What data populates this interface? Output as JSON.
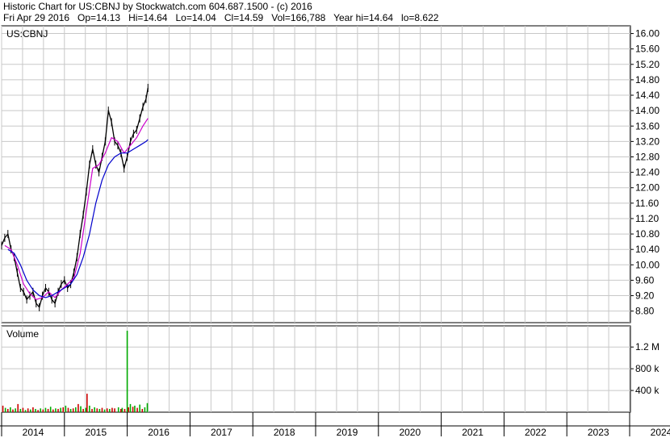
{
  "header": {
    "line1": "Historic Chart for US:CBNJ by Stockwatch.com 604.687.1500 - (c) 2016",
    "line2": "Fri Apr 29 2016   Op=14.13   Hi=14.64   Lo=14.04   Cl=14.59   Vol=166,788   Year hi=14.64   lo=8.622"
  },
  "chart_data": [
    {
      "type": "line",
      "title": "US:CBNJ",
      "ylabel": "",
      "xlabel": "",
      "ylim": [
        8.5,
        16.2
      ],
      "yticks": [
        "16.00",
        "15.60",
        "15.20",
        "14.80",
        "14.40",
        "14.00",
        "13.60",
        "13.20",
        "12.80",
        "12.40",
        "12.00",
        "11.60",
        "11.20",
        "10.80",
        "10.40",
        "10.00",
        "9.60",
        "9.20",
        "8.80"
      ],
      "x_labels": [
        "2014",
        "2015",
        "2016",
        "2017",
        "2018",
        "2019",
        "2020",
        "2021",
        "2022",
        "2023",
        "2024"
      ],
      "grid": true,
      "series": [
        {
          "style": "price",
          "color": "#000000",
          "x": [
            2014.0,
            2014.05,
            2014.1,
            2014.15,
            2014.2,
            2014.25,
            2014.3,
            2014.35,
            2014.4,
            2014.45,
            2014.5,
            2014.55,
            2014.6,
            2014.65,
            2014.7,
            2014.75,
            2014.8,
            2014.85,
            2014.9,
            2014.95,
            2015.0,
            2015.05,
            2015.1,
            2015.15,
            2015.2,
            2015.25,
            2015.3,
            2015.35,
            2015.4,
            2015.45,
            2015.5,
            2015.55,
            2015.6,
            2015.65,
            2015.7,
            2015.75,
            2015.8,
            2015.85,
            2015.9,
            2015.95,
            2016.0,
            2016.05,
            2016.1,
            2016.15,
            2016.2,
            2016.25,
            2016.3,
            2016.33
          ],
          "values": [
            10.5,
            10.7,
            10.8,
            10.4,
            10.2,
            9.8,
            9.4,
            9.3,
            9.1,
            9.2,
            9.3,
            9.0,
            8.9,
            9.2,
            9.4,
            9.3,
            9.1,
            9.0,
            9.3,
            9.5,
            9.6,
            9.4,
            9.5,
            9.8,
            10.2,
            10.8,
            11.3,
            11.9,
            12.6,
            13.0,
            12.6,
            12.4,
            12.8,
            13.2,
            14.0,
            13.7,
            13.2,
            13.1,
            12.9,
            12.5,
            12.8,
            13.2,
            13.4,
            13.5,
            13.8,
            14.1,
            14.3,
            14.59
          ]
        },
        {
          "style": "ma-short",
          "color": "#cc00cc",
          "x": [
            2014.05,
            2014.15,
            2014.25,
            2014.35,
            2014.45,
            2014.55,
            2014.65,
            2014.75,
            2014.85,
            2014.95,
            2015.05,
            2015.15,
            2015.25,
            2015.35,
            2015.45,
            2015.55,
            2015.65,
            2015.75,
            2015.85,
            2015.95,
            2016.05,
            2016.15,
            2016.25,
            2016.33
          ],
          "values": [
            10.5,
            10.4,
            10.0,
            9.5,
            9.25,
            9.1,
            9.15,
            9.3,
            9.15,
            9.35,
            9.5,
            9.65,
            10.3,
            11.4,
            12.5,
            12.6,
            12.9,
            13.3,
            13.2,
            12.9,
            13.1,
            13.3,
            13.6,
            13.8
          ]
        },
        {
          "style": "ma-long",
          "color": "#0000cc",
          "x": [
            2014.1,
            2014.2,
            2014.3,
            2014.4,
            2014.5,
            2014.6,
            2014.7,
            2014.8,
            2014.9,
            2015.0,
            2015.1,
            2015.2,
            2015.3,
            2015.4,
            2015.5,
            2015.6,
            2015.7,
            2015.8,
            2015.9,
            2016.0,
            2016.1,
            2016.2,
            2016.3,
            2016.33
          ],
          "values": [
            10.4,
            10.3,
            10.0,
            9.6,
            9.35,
            9.2,
            9.15,
            9.2,
            9.3,
            9.4,
            9.5,
            9.75,
            10.2,
            10.8,
            11.6,
            12.2,
            12.6,
            12.8,
            12.9,
            12.9,
            13.0,
            13.1,
            13.2,
            13.25
          ]
        }
      ]
    },
    {
      "type": "bar",
      "title": "Volume",
      "ylim": [
        0,
        1500000
      ],
      "yticks": [
        "1.2 M",
        "800 k",
        "400 k"
      ],
      "ytick_values": [
        1200000,
        800000,
        400000
      ],
      "colors": {
        "up": "#00aa00",
        "down": "#cc0000"
      },
      "bars": [
        {
          "x": 2014.02,
          "v": 120000,
          "c": "down"
        },
        {
          "x": 2014.06,
          "v": 80000,
          "c": "up"
        },
        {
          "x": 2014.1,
          "v": 60000,
          "c": "down"
        },
        {
          "x": 2014.14,
          "v": 90000,
          "c": "up"
        },
        {
          "x": 2014.18,
          "v": 50000,
          "c": "down"
        },
        {
          "x": 2014.22,
          "v": 70000,
          "c": "up"
        },
        {
          "x": 2014.26,
          "v": 150000,
          "c": "down"
        },
        {
          "x": 2014.3,
          "v": 60000,
          "c": "up"
        },
        {
          "x": 2014.34,
          "v": 80000,
          "c": "down"
        },
        {
          "x": 2014.38,
          "v": 40000,
          "c": "up"
        },
        {
          "x": 2014.42,
          "v": 70000,
          "c": "down"
        },
        {
          "x": 2014.46,
          "v": 50000,
          "c": "up"
        },
        {
          "x": 2014.5,
          "v": 90000,
          "c": "down"
        },
        {
          "x": 2014.54,
          "v": 60000,
          "c": "up"
        },
        {
          "x": 2014.58,
          "v": 40000,
          "c": "down"
        },
        {
          "x": 2014.62,
          "v": 70000,
          "c": "up"
        },
        {
          "x": 2014.66,
          "v": 50000,
          "c": "down"
        },
        {
          "x": 2014.7,
          "v": 80000,
          "c": "up"
        },
        {
          "x": 2014.74,
          "v": 60000,
          "c": "down"
        },
        {
          "x": 2014.78,
          "v": 100000,
          "c": "up"
        },
        {
          "x": 2014.82,
          "v": 50000,
          "c": "down"
        },
        {
          "x": 2014.86,
          "v": 70000,
          "c": "up"
        },
        {
          "x": 2014.9,
          "v": 60000,
          "c": "down"
        },
        {
          "x": 2014.94,
          "v": 80000,
          "c": "up"
        },
        {
          "x": 2014.98,
          "v": 90000,
          "c": "down"
        },
        {
          "x": 2015.02,
          "v": 120000,
          "c": "up"
        },
        {
          "x": 2015.06,
          "v": 80000,
          "c": "down"
        },
        {
          "x": 2015.1,
          "v": 60000,
          "c": "up"
        },
        {
          "x": 2015.14,
          "v": 70000,
          "c": "down"
        },
        {
          "x": 2015.18,
          "v": 90000,
          "c": "up"
        },
        {
          "x": 2015.22,
          "v": 150000,
          "c": "down"
        },
        {
          "x": 2015.26,
          "v": 110000,
          "c": "up"
        },
        {
          "x": 2015.3,
          "v": 60000,
          "c": "down"
        },
        {
          "x": 2015.34,
          "v": 80000,
          "c": "up"
        },
        {
          "x": 2015.36,
          "v": 340000,
          "c": "down"
        },
        {
          "x": 2015.4,
          "v": 120000,
          "c": "up"
        },
        {
          "x": 2015.44,
          "v": 60000,
          "c": "down"
        },
        {
          "x": 2015.48,
          "v": 90000,
          "c": "up"
        },
        {
          "x": 2015.52,
          "v": 70000,
          "c": "down"
        },
        {
          "x": 2015.56,
          "v": 60000,
          "c": "up"
        },
        {
          "x": 2015.6,
          "v": 80000,
          "c": "down"
        },
        {
          "x": 2015.64,
          "v": 50000,
          "c": "up"
        },
        {
          "x": 2015.68,
          "v": 70000,
          "c": "down"
        },
        {
          "x": 2015.72,
          "v": 60000,
          "c": "up"
        },
        {
          "x": 2015.76,
          "v": 80000,
          "c": "down"
        },
        {
          "x": 2015.8,
          "v": 70000,
          "c": "down"
        },
        {
          "x": 2015.86,
          "v": 90000,
          "c": "up"
        },
        {
          "x": 2015.9,
          "v": 60000,
          "c": "down"
        },
        {
          "x": 2015.92,
          "v": 80000,
          "c": "up"
        },
        {
          "x": 2015.96,
          "v": 60000,
          "c": "down"
        },
        {
          "x": 2016.0,
          "v": 1500000,
          "c": "up"
        },
        {
          "x": 2016.02,
          "v": 90000,
          "c": "down"
        },
        {
          "x": 2016.05,
          "v": 150000,
          "c": "up"
        },
        {
          "x": 2016.09,
          "v": 100000,
          "c": "down"
        },
        {
          "x": 2016.12,
          "v": 120000,
          "c": "up"
        },
        {
          "x": 2016.16,
          "v": 80000,
          "c": "down"
        },
        {
          "x": 2016.2,
          "v": 140000,
          "c": "up"
        },
        {
          "x": 2016.24,
          "v": 60000,
          "c": "down"
        },
        {
          "x": 2016.28,
          "v": 90000,
          "c": "up"
        },
        {
          "x": 2016.32,
          "v": 166788,
          "c": "up"
        }
      ]
    }
  ]
}
